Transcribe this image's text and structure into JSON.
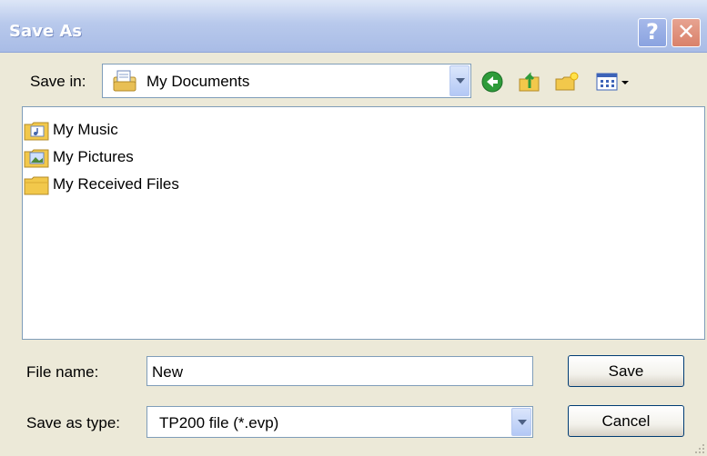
{
  "window": {
    "title": "Save As",
    "help_glyph": "?",
    "close_glyph": "✕"
  },
  "save_in": {
    "label": "Save in:",
    "value": "My Documents",
    "icon": "my-documents-icon"
  },
  "toolbar": {
    "icons": [
      "back-icon",
      "up-folder-icon",
      "new-folder-icon",
      "view-menu-icon"
    ],
    "back_color": "#2e9b3a",
    "folder_color": "#f2c84b"
  },
  "files": {
    "items": [
      {
        "name": "My Music",
        "icon": "music-folder-icon"
      },
      {
        "name": "My Pictures",
        "icon": "pictures-folder-icon"
      },
      {
        "name": "My Received Files",
        "icon": "folder-icon"
      }
    ]
  },
  "form": {
    "file_name_label": "File name:",
    "file_name_value": "New",
    "save_type_label": "Save as type:",
    "save_type_value": "TP200 file (*.evp)",
    "save_button": "Save",
    "cancel_button": "Cancel"
  }
}
